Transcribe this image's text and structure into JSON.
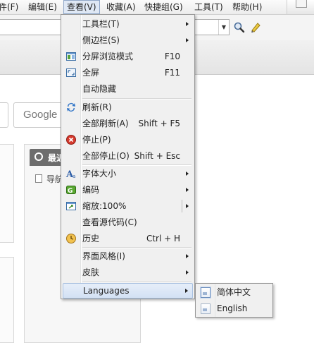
{
  "menubar": {
    "items": [
      {
        "label": "件(F)"
      },
      {
        "label": "编辑(E)"
      },
      {
        "label": "查看(V)"
      },
      {
        "label": "收藏(A)"
      },
      {
        "label": "快捷组(G)"
      },
      {
        "label": "工具(T)"
      },
      {
        "label": "帮助(H)"
      }
    ]
  },
  "content": {
    "search_engine_label": "Google",
    "recent_title": "最近",
    "nav_link": "导航"
  },
  "view_menu": {
    "items": [
      {
        "label": "工具栏(T)",
        "shortcut": "",
        "icon": "",
        "submenu": true
      },
      {
        "label": "侧边栏(S)",
        "shortcut": "",
        "icon": "",
        "submenu": true
      },
      {
        "label": "分屏浏览模式",
        "shortcut": "F10",
        "icon": "split-screen-icon",
        "submenu": false
      },
      {
        "label": "全屏",
        "shortcut": "F11",
        "icon": "fullscreen-icon",
        "submenu": false
      },
      {
        "label": "自动隐藏",
        "shortcut": "",
        "icon": "",
        "submenu": false
      },
      {
        "label": "刷新(R)",
        "shortcut": "",
        "icon": "refresh-icon",
        "submenu": false
      },
      {
        "label": "全部刷新(A)",
        "shortcut": "Shift + F5",
        "icon": "",
        "submenu": false
      },
      {
        "label": "停止(P)",
        "shortcut": "",
        "icon": "stop-icon",
        "submenu": false
      },
      {
        "label": "全部停止(O)",
        "shortcut": "Shift + Esc",
        "icon": "",
        "submenu": false
      },
      {
        "label": "字体大小",
        "shortcut": "",
        "icon": "font-size-icon",
        "submenu": true
      },
      {
        "label": "编码",
        "shortcut": "",
        "icon": "encoding-icon",
        "submenu": true
      },
      {
        "label": "缩放:100%",
        "shortcut": "",
        "icon": "zoom-icon",
        "submenu": true
      },
      {
        "label": "查看源代码(C)",
        "shortcut": "",
        "icon": "",
        "submenu": false
      },
      {
        "label": "历史",
        "shortcut": "Ctrl + H",
        "icon": "history-icon",
        "submenu": false
      },
      {
        "label": "界面风格(I)",
        "shortcut": "",
        "icon": "",
        "submenu": true
      },
      {
        "label": "皮肤",
        "shortcut": "",
        "icon": "",
        "submenu": true
      },
      {
        "label": "Languages",
        "shortcut": "",
        "icon": "",
        "submenu": true
      }
    ]
  },
  "languages_menu": {
    "items": [
      {
        "label": "简体中文",
        "checked": true
      },
      {
        "label": "English",
        "checked": false
      }
    ]
  },
  "colors": {
    "menu_bg": "#f0f0f0",
    "highlight": "#d3e1f4",
    "highlight_border": "#a8c0e0"
  }
}
